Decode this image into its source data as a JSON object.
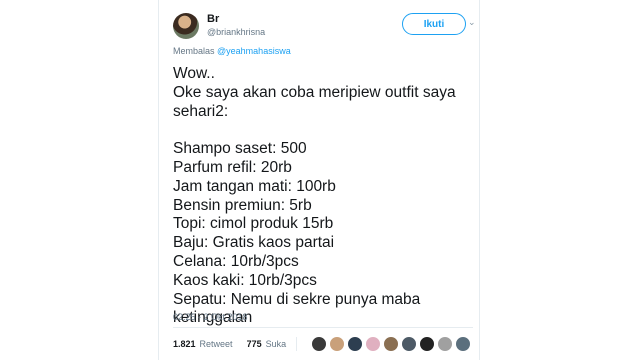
{
  "user": {
    "name": "Br",
    "handle": "@briankhrisna",
    "follow_label": "Ikuti"
  },
  "reply": {
    "prefix": "Membalas",
    "mention": "@yeahmahasiswa"
  },
  "tweet_lines": [
    "Wow..",
    "Oke saya akan coba meripiew outfit saya",
    "sehari2:",
    "",
    "Shampo saset: 500",
    "Parfum refil: 20rb",
    "Jam tangan mati: 100rb",
    "Bensin premiun: 5rb",
    "Topi: cimol produk 15rb",
    "Baju: Gratis kaos partai",
    "Celana: 10rb/3pcs",
    "Kaos kaki: 10rb/3pcs",
    "Sepatu: Nemu di sekre punya maba",
    "ketinggalan"
  ],
  "timestamp": "02.25 - 2 Okt 2018",
  "stats": {
    "retweets": "1.821",
    "retweet_label": "Retweet",
    "likes": "775",
    "like_label": "Suka"
  },
  "liker_avatars": [
    {
      "color": "#3a3a3a",
      "icon": "avatar-icon"
    },
    {
      "color": "#c9a07a",
      "icon": "avatar-icon"
    },
    {
      "color": "#2d3e50",
      "icon": "avatar-icon"
    },
    {
      "color": "#e0b0c0",
      "icon": "avatar-icon"
    },
    {
      "color": "#8a6f52",
      "icon": "avatar-icon"
    },
    {
      "color": "#4d5a66",
      "icon": "avatar-icon"
    },
    {
      "color": "#222222",
      "icon": "avatar-icon"
    },
    {
      "color": "#a0a0a0",
      "icon": "avatar-icon"
    },
    {
      "color": "#5b6f7d",
      "icon": "avatar-icon"
    }
  ],
  "colors": {
    "accent": "#1da1f2",
    "text": "#14171a",
    "muted": "#657786"
  }
}
